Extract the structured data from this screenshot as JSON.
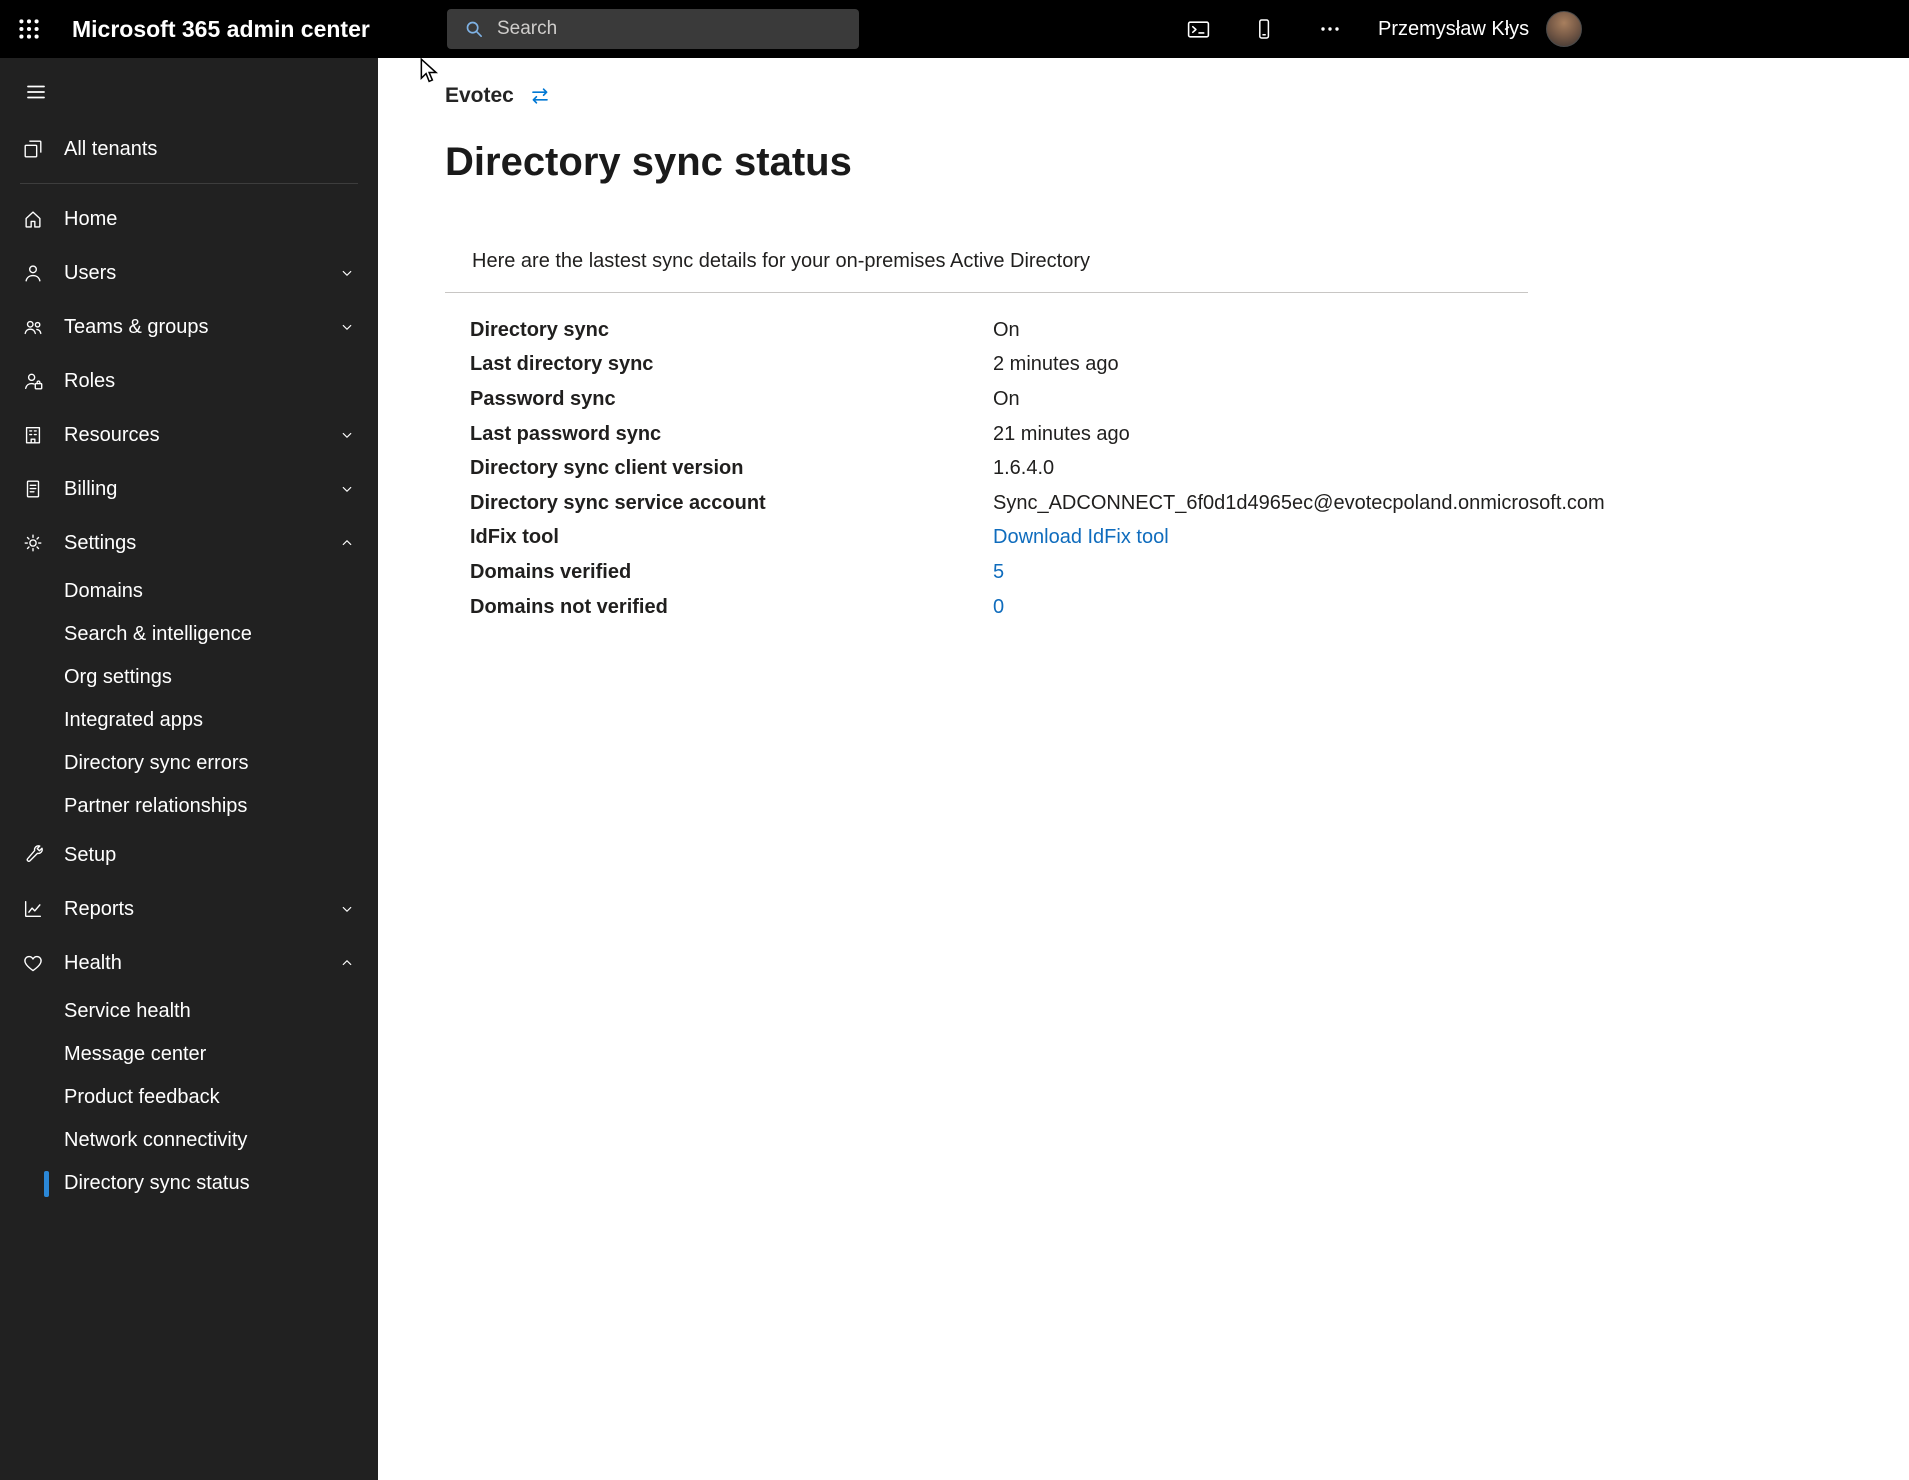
{
  "topbar": {
    "app_title": "Microsoft 365 admin center",
    "search_placeholder": "Search",
    "user_name": "Przemysław Kłys"
  },
  "icons": {
    "topbar": [
      "app-launcher",
      "search",
      "console",
      "mobile-app",
      "more",
      "avatar"
    ],
    "sidebar": [
      "menu",
      "all-tenants",
      "home",
      "users",
      "teams-groups",
      "roles",
      "resources",
      "billing",
      "settings",
      "setup",
      "reports",
      "health",
      "chevron-down",
      "chevron-up"
    ],
    "content": [
      "tenant-switch",
      "cursor-arrow"
    ]
  },
  "colors": {
    "topbar_bg": "#000000",
    "sidebar_bg": "#212121",
    "accent": "#2b88d8",
    "link": "#0f6cbd"
  },
  "sidebar": {
    "items": [
      {
        "label": "All tenants"
      },
      {
        "label": "Home"
      },
      {
        "label": "Users",
        "chevron": "down"
      },
      {
        "label": "Teams & groups",
        "chevron": "down"
      },
      {
        "label": "Roles"
      },
      {
        "label": "Resources",
        "chevron": "down"
      },
      {
        "label": "Billing",
        "chevron": "down"
      },
      {
        "label": "Settings",
        "chevron": "up",
        "expanded": true
      },
      {
        "label": "Domains",
        "sub": true
      },
      {
        "label": "Search & intelligence",
        "sub": true
      },
      {
        "label": "Org settings",
        "sub": true
      },
      {
        "label": "Integrated apps",
        "sub": true
      },
      {
        "label": "Directory sync errors",
        "sub": true
      },
      {
        "label": "Partner relationships",
        "sub": true
      },
      {
        "label": "Setup"
      },
      {
        "label": "Reports",
        "chevron": "down"
      },
      {
        "label": "Health",
        "chevron": "up",
        "expanded": true
      },
      {
        "label": "Service health",
        "sub": true
      },
      {
        "label": "Message center",
        "sub": true
      },
      {
        "label": "Product feedback",
        "sub": true
      },
      {
        "label": "Network connectivity",
        "sub": true
      },
      {
        "label": "Directory sync status",
        "sub": true,
        "selected": true
      }
    ]
  },
  "main": {
    "tenant_name": "Evotec",
    "page_title": "Directory sync status",
    "intro": "Here are the lastest sync details for your on-premises Active Directory",
    "rows": [
      {
        "label": "Directory sync",
        "value": "On"
      },
      {
        "label": "Last directory sync",
        "value": "2 minutes ago"
      },
      {
        "label": "Password sync",
        "value": "On"
      },
      {
        "label": "Last password sync",
        "value": "21 minutes ago"
      },
      {
        "label": "Directory sync client version",
        "value": "1.6.4.0"
      },
      {
        "label": "Directory sync service account",
        "value": "Sync_ADCONNECT_6f0d1d4965ec@evotecpoland.onmicrosoft.com"
      },
      {
        "label": "IdFix tool",
        "value": "Download IdFix tool",
        "link": true
      },
      {
        "label": "Domains verified",
        "value": "5",
        "link": true
      },
      {
        "label": "Domains not verified",
        "value": "0",
        "link": true
      }
    ]
  }
}
